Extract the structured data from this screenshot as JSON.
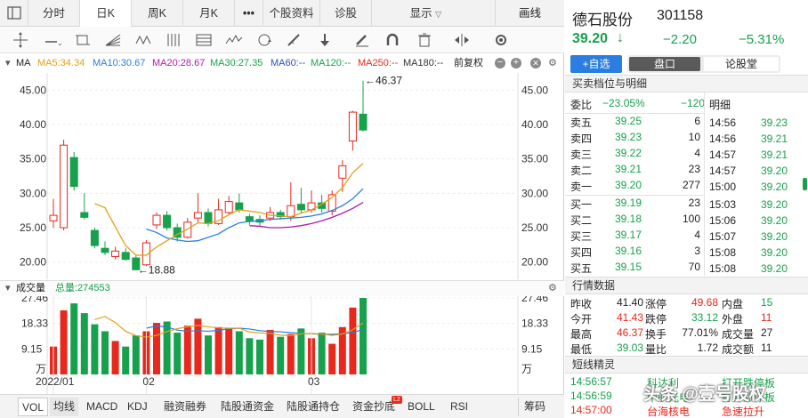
{
  "top_tabs": [
    "分时",
    "日K",
    "周K",
    "月K",
    "•••",
    "个股资料",
    "诊股"
  ],
  "display_menu": "显示",
  "draw_label": "画线",
  "ma_line": {
    "label": "MA",
    "items": [
      {
        "text": "MA5:34.34",
        "color": "#e0a11b"
      },
      {
        "text": "MA10:30.67",
        "color": "#2a7de1"
      },
      {
        "text": "MA20:28.67",
        "color": "#b11aa8"
      },
      {
        "text": "MA30:27.35",
        "color": "#16a14c"
      },
      {
        "text": "MA60:--",
        "color": "#2b4cc6"
      },
      {
        "text": "MA120:--",
        "color": "#17a14c"
      },
      {
        "text": "MA250:--",
        "color": "#e8281c"
      },
      {
        "text": "MA180:--",
        "color": "#333333"
      }
    ],
    "adjust": "前复权"
  },
  "chart_data": [
    {
      "type": "candlestick",
      "title": "",
      "y_ticks": [
        "45.00",
        "40.00",
        "35.00",
        "30.00",
        "25.00",
        "20.00"
      ],
      "ylim": [
        17.5,
        47.5
      ],
      "annotations": {
        "high": "46.37",
        "low": "18.88"
      },
      "candles": [
        {
          "o": 26.0,
          "c": 26.8,
          "h": 29.2,
          "l": 25.0
        },
        {
          "o": 25.0,
          "c": 37.0,
          "h": 37.8,
          "l": 24.6
        },
        {
          "o": 35.2,
          "c": 31.0,
          "h": 36.0,
          "l": 30.4
        },
        {
          "o": 27.2,
          "c": 26.5,
          "h": 30.0,
          "l": 26.2
        },
        {
          "o": 24.6,
          "c": 22.4,
          "h": 25.0,
          "l": 22.0
        },
        {
          "o": 22.0,
          "c": 21.4,
          "h": 23.0,
          "l": 21.0
        },
        {
          "o": 20.8,
          "c": 21.6,
          "h": 22.2,
          "l": 20.4
        },
        {
          "o": 21.4,
          "c": 20.4,
          "h": 22.0,
          "l": 20.2
        },
        {
          "o": 20.6,
          "c": 18.88,
          "h": 21.0,
          "l": 18.88
        },
        {
          "o": 19.6,
          "c": 22.8,
          "h": 23.2,
          "l": 19.4
        },
        {
          "o": 25.4,
          "c": 26.8,
          "h": 27.2,
          "l": 24.8
        },
        {
          "o": 26.8,
          "c": 25.0,
          "h": 27.4,
          "l": 24.6
        },
        {
          "o": 25.0,
          "c": 23.6,
          "h": 25.6,
          "l": 23.0
        },
        {
          "o": 23.6,
          "c": 25.8,
          "h": 26.4,
          "l": 23.4
        },
        {
          "o": 26.4,
          "c": 27.2,
          "h": 30.0,
          "l": 25.8
        },
        {
          "o": 27.2,
          "c": 25.6,
          "h": 27.8,
          "l": 25.2
        },
        {
          "o": 25.6,
          "c": 27.6,
          "h": 29.2,
          "l": 25.4
        },
        {
          "o": 27.2,
          "c": 28.8,
          "h": 29.6,
          "l": 26.8
        },
        {
          "o": 28.6,
          "c": 27.6,
          "h": 30.0,
          "l": 27.2
        },
        {
          "o": 26.6,
          "c": 26.0,
          "h": 27.0,
          "l": 25.4
        },
        {
          "o": 26.2,
          "c": 25.8,
          "h": 26.8,
          "l": 25.2
        },
        {
          "o": 26.4,
          "c": 27.2,
          "h": 28.0,
          "l": 26.0
        },
        {
          "o": 27.2,
          "c": 26.6,
          "h": 27.6,
          "l": 26.2
        },
        {
          "o": 26.6,
          "c": 28.2,
          "h": 31.6,
          "l": 26.0
        },
        {
          "o": 28.4,
          "c": 27.6,
          "h": 30.8,
          "l": 27.2
        },
        {
          "o": 27.6,
          "c": 28.6,
          "h": 30.4,
          "l": 27.2
        },
        {
          "o": 28.6,
          "c": 27.8,
          "h": 29.8,
          "l": 27.2
        },
        {
          "o": 27.4,
          "c": 29.8,
          "h": 30.4,
          "l": 26.8
        },
        {
          "o": 32.2,
          "c": 34.0,
          "h": 34.8,
          "l": 30.2
        },
        {
          "o": 37.6,
          "c": 41.8,
          "h": 42.0,
          "l": 36.2
        },
        {
          "o": 41.5,
          "c": 39.2,
          "h": 46.37,
          "l": 39.0
        }
      ],
      "ma5": [
        null,
        null,
        null,
        null,
        28.5,
        27.9,
        25.1,
        22.4,
        21.0,
        21.0,
        22.2,
        23.1,
        24.0,
        24.8,
        25.7,
        25.6,
        26.0,
        26.9,
        27.6,
        27.4,
        27.2,
        26.8,
        26.7,
        26.6,
        27.1,
        27.6,
        28.4,
        29.4,
        30.8,
        33.0,
        34.34
      ],
      "ma10": [
        null,
        null,
        null,
        null,
        null,
        null,
        null,
        null,
        null,
        24.8,
        24.3,
        23.5,
        23.2,
        23.0,
        23.1,
        23.6,
        24.1,
        25.0,
        25.7,
        25.9,
        26.0,
        26.2,
        26.3,
        26.4,
        26.5,
        26.7,
        27.0,
        27.5,
        28.2,
        29.2,
        30.67
      ],
      "ma20": [
        null,
        null,
        null,
        null,
        null,
        null,
        null,
        null,
        null,
        null,
        null,
        null,
        null,
        null,
        null,
        null,
        null,
        null,
        null,
        25.3,
        25.2,
        25.0,
        25.0,
        25.1,
        25.3,
        25.6,
        26.0,
        26.5,
        27.1,
        27.8,
        28.67
      ],
      "ma30": [
        null,
        null,
        null,
        null,
        null,
        null,
        null,
        null,
        null,
        null,
        null,
        null,
        null,
        null,
        null,
        null,
        null,
        null,
        null,
        null,
        null,
        null,
        null,
        null,
        null,
        null,
        null,
        null,
        null,
        null,
        27.35
      ]
    },
    {
      "type": "bar",
      "title": "成交量",
      "total_label": "总量:274553",
      "y_ticks": [
        "27.46",
        "18.33",
        "9.15"
      ],
      "y_unit": "万",
      "ylim": [
        0,
        27.46
      ],
      "x_labels": [
        {
          "index": 0,
          "text": "2022/01"
        },
        {
          "index": 9,
          "text": "02"
        },
        {
          "index": 25,
          "text": "03"
        }
      ],
      "values": [
        10.0,
        23.0,
        25.5,
        22.0,
        18.0,
        15.5,
        12.0,
        10.0,
        14.0,
        15.5,
        18.5,
        19.0,
        15.0,
        17.5,
        20.0,
        14.0,
        17.0,
        16.5,
        15.5,
        13.0,
        12.5,
        16.0,
        13.5,
        14.5,
        16.5,
        13.0,
        15.0,
        11.0,
        17.0,
        24.0,
        27.46
      ],
      "ma_a": [
        null,
        null,
        null,
        null,
        19.7,
        20.8,
        18.6,
        15.5,
        13.9,
        13.4,
        14.0,
        15.4,
        16.4,
        17.1,
        17.6,
        17.1,
        16.7,
        16.6,
        16.6,
        15.2,
        14.9,
        14.7,
        14.1,
        13.9,
        14.6,
        14.7,
        14.5,
        14.0,
        14.5,
        16.0,
        18.5
      ],
      "ma_b": [
        null,
        null,
        null,
        null,
        null,
        null,
        null,
        null,
        null,
        16.6,
        17.4,
        17.0,
        15.9,
        15.5,
        15.7,
        15.5,
        15.8,
        16.4,
        16.6,
        16.3,
        15.7,
        15.4,
        15.3,
        15.0,
        14.7,
        14.6,
        14.4,
        14.4,
        14.6,
        15.0,
        16.2
      ]
    }
  ],
  "bottom_tabs": [
    "VOL",
    "均线",
    "MACD",
    "KDJ",
    "融资融券",
    "陆股通资金",
    "陆股通持仓",
    "资金抄底",
    "BOLL",
    "RSI",
    "筹码"
  ],
  "bottom_badge": "L2",
  "stock": {
    "name": "德石股份",
    "code": "301158",
    "price": "39.20",
    "arrow": "↓",
    "change": "−2.20",
    "pct": "−5.31%"
  },
  "actions": {
    "watch": "+自选",
    "tab_pankou": "盘口",
    "tab_forum": "论股堂"
  },
  "order_book_title": "买卖档位与明细",
  "weibi": {
    "label": "委比",
    "pct": "−23.05%",
    "value": "−120"
  },
  "detail_title": "明细",
  "asks": [
    {
      "label": "卖五",
      "price": "39.25",
      "vol": "6"
    },
    {
      "label": "卖四",
      "price": "39.23",
      "vol": "10"
    },
    {
      "label": "卖三",
      "price": "39.22",
      "vol": "4"
    },
    {
      "label": "卖二",
      "price": "39.21",
      "vol": "23"
    },
    {
      "label": "卖一",
      "price": "39.20",
      "vol": "277"
    }
  ],
  "bids": [
    {
      "label": "买一",
      "price": "39.19",
      "vol": "23"
    },
    {
      "label": "买二",
      "price": "39.18",
      "vol": "100"
    },
    {
      "label": "买三",
      "price": "39.17",
      "vol": "4"
    },
    {
      "label": "买四",
      "price": "39.16",
      "vol": "3"
    },
    {
      "label": "买五",
      "price": "39.15",
      "vol": "70"
    }
  ],
  "ticks": [
    {
      "time": "14:56",
      "price": "39.23"
    },
    {
      "time": "14:56",
      "price": "39.21"
    },
    {
      "time": "14:57",
      "price": "39.21"
    },
    {
      "time": "14:57",
      "price": "39.20"
    },
    {
      "time": "15:00",
      "price": "39.20"
    },
    {
      "time": "15:03",
      "price": "39.20"
    },
    {
      "time": "15:06",
      "price": "39.20"
    },
    {
      "time": "15:07",
      "price": "39.20"
    },
    {
      "time": "15:08",
      "price": "39.20"
    },
    {
      "time": "15:08",
      "price": "39.20"
    }
  ],
  "quote_title": "行情数据",
  "quote": [
    [
      {
        "label": "昨收",
        "value": "41.40",
        "color": "#222222"
      },
      {
        "label": "涨停",
        "value": "49.68",
        "color": "#e8281c"
      },
      {
        "label": "内盘",
        "value": "15",
        "color": "#17a14c"
      }
    ],
    [
      {
        "label": "今开",
        "value": "41.43",
        "color": "#e8281c"
      },
      {
        "label": "跌停",
        "value": "33.12",
        "color": "#17a14c"
      },
      {
        "label": "外盘",
        "value": "11",
        "color": "#e8281c"
      }
    ],
    [
      {
        "label": "最高",
        "value": "46.37",
        "color": "#e8281c"
      },
      {
        "label": "换手",
        "value": "77.01%",
        "color": "#222222"
      },
      {
        "label": "成交量",
        "value": "27",
        "color": "#222222"
      }
    ],
    [
      {
        "label": "最低",
        "value": "39.03",
        "color": "#17a14c"
      },
      {
        "label": "量比",
        "value": "1.72",
        "color": "#222222"
      },
      {
        "label": "成交额",
        "value": "11",
        "color": "#222222"
      }
    ]
  ],
  "sprite_title": "短线精灵",
  "sprites": [
    {
      "time": "14:56:57",
      "name": "科达利",
      "event": "打开跌停板",
      "color": "#17a14c"
    },
    {
      "time": "14:56:59",
      "name": "中航光电",
      "event": "打开涨停板",
      "color": "#17a14c"
    },
    {
      "time": "14:57:00",
      "name": "台海核电",
      "event": "急速拉升",
      "color": "#e8281c"
    }
  ],
  "watermark": "头条 @壹号股权"
}
